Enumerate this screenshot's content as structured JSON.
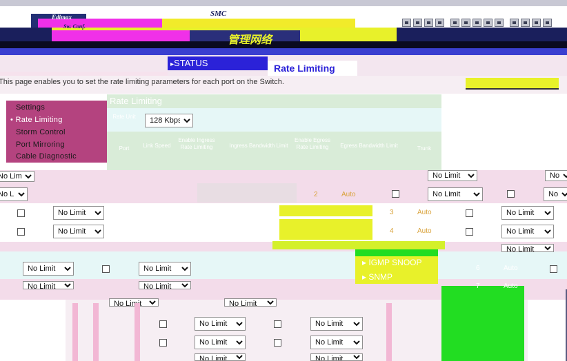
{
  "header": {
    "brand_small": "Edimax",
    "brand_tag": "Sw. Conf.",
    "logo_text": "SMC",
    "banner_text": "管理网络",
    "port_count": 13
  },
  "nav": {
    "status_label": "STATUS",
    "page_title": "Rate Limiting",
    "igmp_label": "IGMP SNOOP",
    "snmp_label": "SNMP"
  },
  "description": "This page enables you to set the rate limiting parameters for each port on the Switch.",
  "side_menu": {
    "items": [
      {
        "label": "Settings",
        "active": false
      },
      {
        "label": "Rate Limiting",
        "active": true
      },
      {
        "label": "Storm Control",
        "active": false
      },
      {
        "label": "Port Mirroring",
        "active": false
      },
      {
        "label": "Cable Diagnostic",
        "active": false
      }
    ]
  },
  "panel": {
    "title": "Rate Limiting",
    "rate_unit_label": "Rate Unit",
    "rate_unit_value": "128 Kbps",
    "columns": [
      "Port",
      "Link Speed",
      "Enable Ingress Rate Limiting",
      "Ingress Bandwidth Limit",
      "Enable Egress Rate Limiting",
      "Egress Bandwidth Limit",
      "Trunk"
    ]
  },
  "common": {
    "no_limit": "No Limit",
    "auto": "Auto"
  },
  "ports": [
    {
      "port": "2",
      "speed": "Auto"
    },
    {
      "port": "3",
      "speed": "Auto"
    },
    {
      "port": "4",
      "speed": "Auto"
    },
    {
      "port": "6",
      "speed": "Auto"
    },
    {
      "port": "7",
      "speed": "Auto"
    }
  ],
  "colors": {
    "accent_magenta": "#b4437f",
    "nav_blue": "#2b22d8",
    "header_navy": "#1a1f5c",
    "panel_green": "#d9ecd8",
    "highlight_yellow": "#e8f12a",
    "highlight_green": "#22dd22"
  }
}
